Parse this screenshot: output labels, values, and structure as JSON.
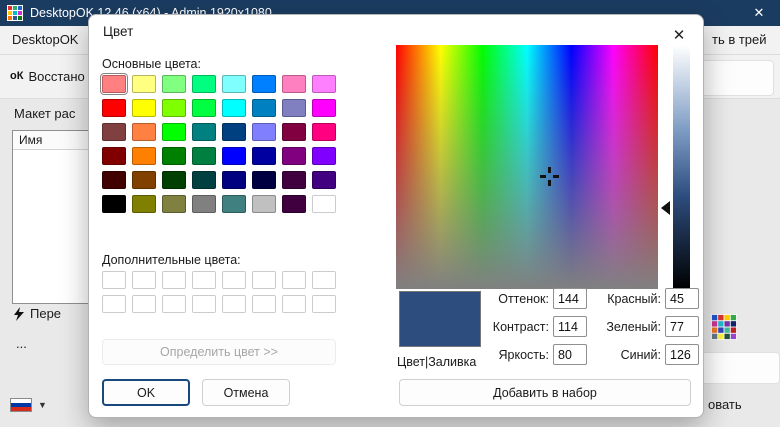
{
  "app_window": {
    "title": "DesktopOK 12.46 (x64) - Admin 1920x1080",
    "menu_item": "DesktopOK",
    "tray_menu_partial": "ть в трей",
    "restore_label": "Восстано",
    "logo_icon_text": "оК",
    "layout_label": "Макет рас",
    "list_header": "Имя",
    "move_label": "Пере",
    "ellipsis_label": "...",
    "bottom_right_partial": "овать",
    "language_dropdown_icon": "▼"
  },
  "icons": {
    "close": "✕"
  },
  "colors": {
    "titlebar": "#1B3C61",
    "ok_focus_border": "#17497F"
  },
  "dialog": {
    "title": "Цвет",
    "basic_colors_label": "Основные цвета:",
    "custom_colors_label": "Дополнительные цвета:",
    "define_color_button": "Определить цвет >>",
    "ok_button": "OK",
    "cancel_button": "Отмена",
    "add_to_set_button": "Добавить в набор",
    "preview_label": "Цвет|Заливка",
    "preview_color": "#2D4D7E",
    "fields": {
      "hue": {
        "label": "Оттенок:",
        "value": "144"
      },
      "contrast": {
        "label": "Контраст:",
        "value": "114"
      },
      "brightness": {
        "label": "Яркость:",
        "value": "80"
      },
      "red": {
        "label": "Красный:",
        "value": "45"
      },
      "green": {
        "label": "Зеленый:",
        "value": "77"
      },
      "blue": {
        "label": "Синий:",
        "value": "126"
      }
    },
    "basic_colors": [
      "#FF8080",
      "#FFFF80",
      "#80FF80",
      "#00FF80",
      "#80FFFF",
      "#0080FF",
      "#FF80C0",
      "#FF80FF",
      "#FF0000",
      "#FFFF00",
      "#80FF00",
      "#00FF40",
      "#00FFFF",
      "#0080C0",
      "#8080C0",
      "#FF00FF",
      "#804040",
      "#FF8040",
      "#00FF00",
      "#008080",
      "#004080",
      "#8080FF",
      "#800040",
      "#FF0080",
      "#800000",
      "#FF8000",
      "#008000",
      "#008040",
      "#0000FF",
      "#0000A0",
      "#800080",
      "#8000FF",
      "#400000",
      "#804000",
      "#004000",
      "#004040",
      "#000080",
      "#000040",
      "#400040",
      "#400080",
      "#000000",
      "#808000",
      "#808040",
      "#808080",
      "#408080",
      "#C0C0C0",
      "#400040",
      "#FFFFFF"
    ],
    "custom_colors": [
      "#FFFFFF",
      "#FFFFFF",
      "#FFFFFF",
      "#FFFFFF",
      "#FFFFFF",
      "#FFFFFF",
      "#FFFFFF",
      "#FFFFFF",
      "#FFFFFF",
      "#FFFFFF",
      "#FFFFFF",
      "#FFFFFF",
      "#FFFFFF",
      "#FFFFFF",
      "#FFFFFF",
      "#FFFFFF"
    ]
  }
}
